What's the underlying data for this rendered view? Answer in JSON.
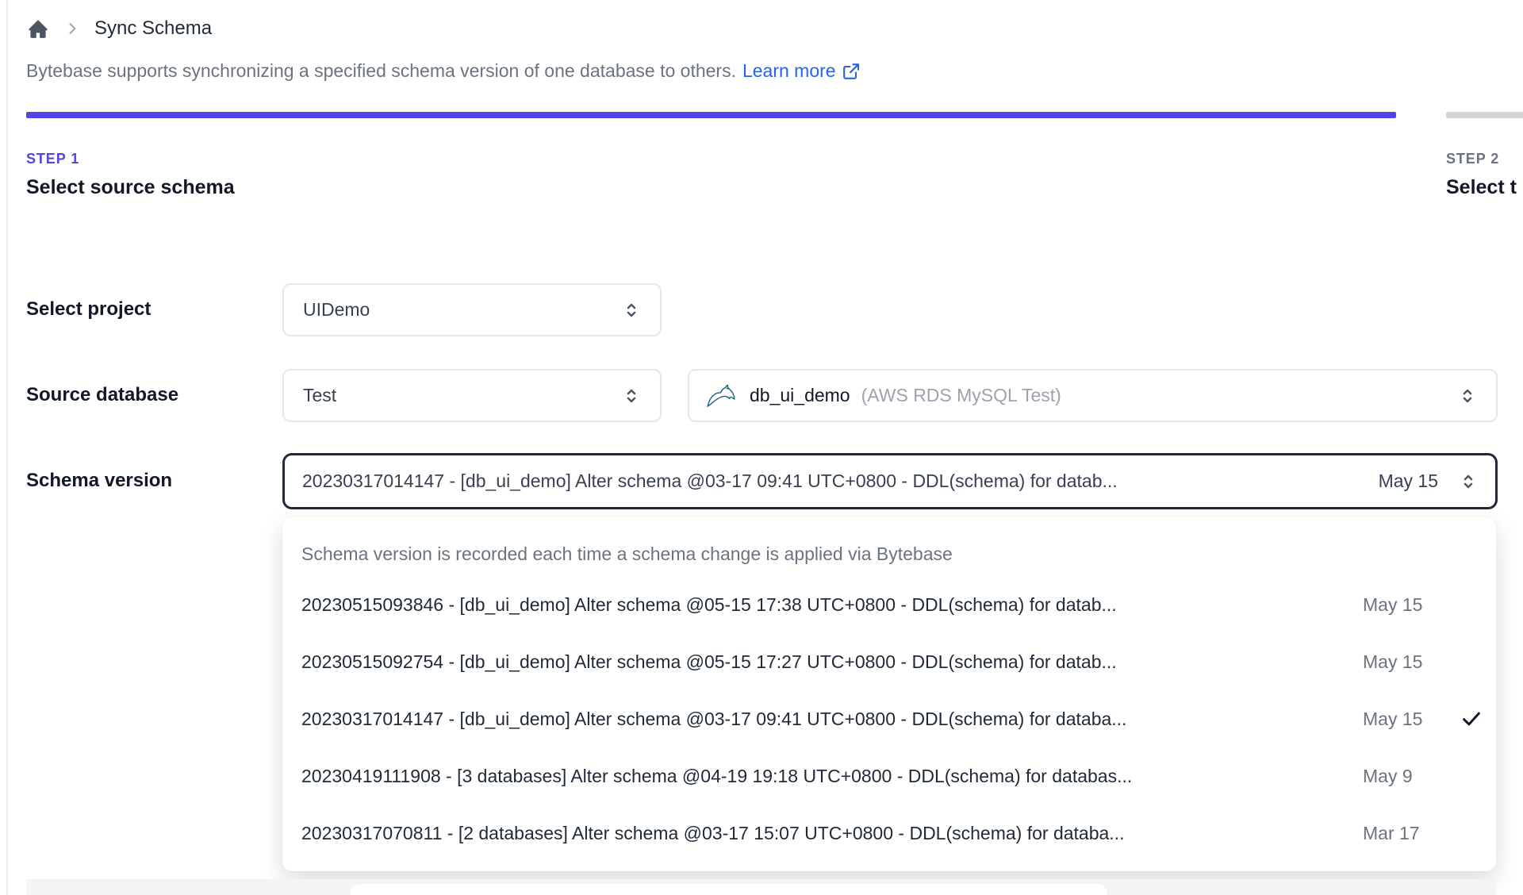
{
  "breadcrumb": {
    "title": "Sync Schema"
  },
  "intro": {
    "text": "Bytebase supports synchronizing a specified schema version of one database to others.",
    "link_label": "Learn more"
  },
  "steps": [
    {
      "step_label": "STEP 1",
      "title": "Select source schema",
      "active": true
    },
    {
      "step_label": "STEP 2",
      "title": "Select t",
      "active": false
    }
  ],
  "form": {
    "project": {
      "label": "Select project",
      "value": "UIDemo"
    },
    "source_database": {
      "label": "Source database",
      "environment": "Test",
      "database": "db_ui_demo",
      "instance": "(AWS RDS MySQL Test)"
    },
    "schema_version": {
      "label": "Schema version",
      "value": "20230317014147 - [db_ui_demo] Alter schema @03-17 09:41 UTC+0800 - DDL(schema) for datab...",
      "date": "May 15"
    }
  },
  "dropdown": {
    "header": "Schema version is recorded each time a schema change is applied via Bytebase",
    "options": [
      {
        "text": "20230515093846 - [db_ui_demo] Alter schema @05-15 17:38 UTC+0800 - DDL(schema) for datab...",
        "date": "May 15",
        "selected": false
      },
      {
        "text": "20230515092754 - [db_ui_demo] Alter schema @05-15 17:27 UTC+0800 - DDL(schema) for datab...",
        "date": "May 15",
        "selected": false
      },
      {
        "text": "20230317014147 - [db_ui_demo] Alter schema @03-17 09:41 UTC+0800 - DDL(schema) for databa...",
        "date": "May 15",
        "selected": true
      },
      {
        "text": "20230419111908 - [3 databases] Alter schema @04-19 19:18 UTC+0800 - DDL(schema) for databas...",
        "date": "May 9",
        "selected": false
      },
      {
        "text": "20230317070811 - [2 databases] Alter schema @03-17 15:07 UTC+0800 - DDL(schema) for databa...",
        "date": "Mar 17",
        "selected": false
      }
    ]
  },
  "icons": {
    "home": "home-icon",
    "breadcrumb_chevron": "chevron-right-icon",
    "external_link": "external-link-icon",
    "select_chevrons": "chevron-up-down-icon",
    "mysql": "mysql-dolphin-icon",
    "selected_check": "check-icon"
  },
  "colors": {
    "accent_indigo": "#4f46e5",
    "link_blue": "#2563eb",
    "inactive_bar": "#d4d4d8",
    "text_muted": "#6b7280",
    "focused_border": "#1f2937"
  }
}
